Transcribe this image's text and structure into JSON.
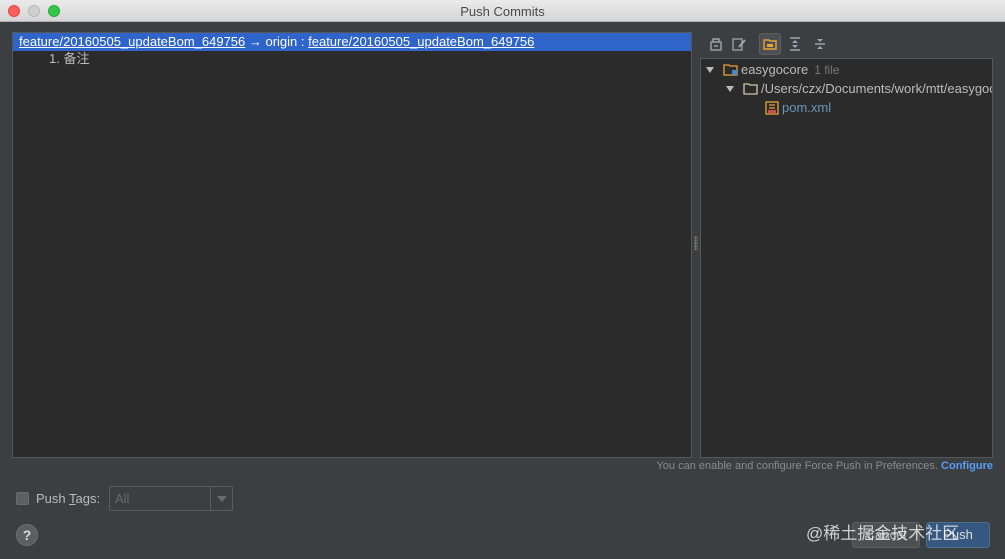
{
  "window": {
    "title": "Push Commits"
  },
  "commits_panel": {
    "branch_local": "feature/20160505_updateBom_649756",
    "branch_separator": " → origin : ",
    "branch_remote": "feature/20160505_updateBom_649756",
    "commits": [
      "1. 备注"
    ]
  },
  "tree": {
    "root_name": "easygocore",
    "root_count": "1 file",
    "folder_path": "/Users/czx/Documents/work/mtt/easygocore",
    "file_name": "pom.xml"
  },
  "hint": {
    "text": "You can enable and configure Force Push in Preferences.",
    "link": "Configure"
  },
  "push_tags": {
    "label_prefix": "Push ",
    "label_mnemonic": "T",
    "label_suffix": "ags:",
    "selected": "All"
  },
  "buttons": {
    "help": "?",
    "cancel": "Cancel",
    "push": "Push"
  },
  "watermark": "@稀土掘金技术社区",
  "colors": {
    "selection": "#2f65ca",
    "file_link": "#6897bb",
    "configure_link": "#589df6"
  }
}
